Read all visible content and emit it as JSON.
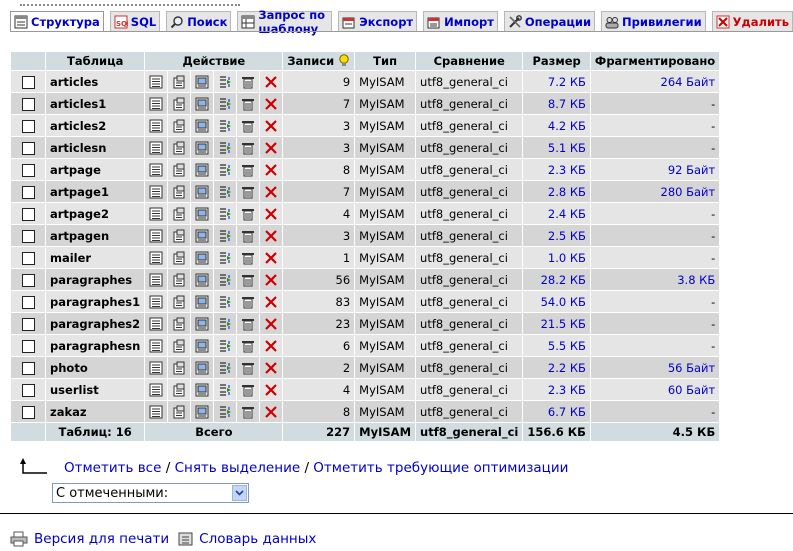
{
  "tabs": [
    {
      "label": "Структура",
      "icon": "structure-icon",
      "active": true
    },
    {
      "label": "SQL",
      "icon": "sql-icon"
    },
    {
      "label": "Поиск",
      "icon": "search-icon"
    },
    {
      "label": "Запрос по шаблону",
      "icon": "query-icon"
    },
    {
      "label": "Экспорт",
      "icon": "export-icon"
    },
    {
      "label": "Импорт",
      "icon": "import-icon"
    },
    {
      "label": "Операции",
      "icon": "operations-icon"
    },
    {
      "label": "Привилегии",
      "icon": "privileges-icon"
    },
    {
      "label": "Удалить",
      "icon": "drop-icon"
    }
  ],
  "table": {
    "headers": {
      "table": "Таблица",
      "action": "Действие",
      "records": "Записи",
      "type": "Тип",
      "collation": "Сравнение",
      "size": "Размер",
      "overhead": "Фрагментировано"
    },
    "rows": [
      {
        "name": "articles",
        "records": "9",
        "type": "MyISAM",
        "collation": "utf8_general_ci",
        "size": "7.2 КБ",
        "overhead": "264 Байт"
      },
      {
        "name": "articles1",
        "records": "7",
        "type": "MyISAM",
        "collation": "utf8_general_ci",
        "size": "8.7 КБ",
        "overhead": "-"
      },
      {
        "name": "articles2",
        "records": "3",
        "type": "MyISAM",
        "collation": "utf8_general_ci",
        "size": "4.2 КБ",
        "overhead": "-"
      },
      {
        "name": "articlesn",
        "records": "3",
        "type": "MyISAM",
        "collation": "utf8_general_ci",
        "size": "5.1 КБ",
        "overhead": "-"
      },
      {
        "name": "artpage",
        "records": "8",
        "type": "MyISAM",
        "collation": "utf8_general_ci",
        "size": "2.3 КБ",
        "overhead": "92 Байт"
      },
      {
        "name": "artpage1",
        "records": "7",
        "type": "MyISAM",
        "collation": "utf8_general_ci",
        "size": "2.8 КБ",
        "overhead": "280 Байт"
      },
      {
        "name": "artpage2",
        "records": "4",
        "type": "MyISAM",
        "collation": "utf8_general_ci",
        "size": "2.4 КБ",
        "overhead": "-"
      },
      {
        "name": "artpagen",
        "records": "3",
        "type": "MyISAM",
        "collation": "utf8_general_ci",
        "size": "2.5 КБ",
        "overhead": "-"
      },
      {
        "name": "mailer",
        "records": "1",
        "type": "MyISAM",
        "collation": "utf8_general_ci",
        "size": "1.0 КБ",
        "overhead": "-"
      },
      {
        "name": "paragraphes",
        "records": "56",
        "type": "MyISAM",
        "collation": "utf8_general_ci",
        "size": "28.2 КБ",
        "overhead": "3.8 КБ"
      },
      {
        "name": "paragraphes1",
        "records": "83",
        "type": "MyISAM",
        "collation": "utf8_general_ci",
        "size": "54.0 КБ",
        "overhead": "-"
      },
      {
        "name": "paragraphes2",
        "records": "23",
        "type": "MyISAM",
        "collation": "utf8_general_ci",
        "size": "21.5 КБ",
        "overhead": "-"
      },
      {
        "name": "paragraphesn",
        "records": "6",
        "type": "MyISAM",
        "collation": "utf8_general_ci",
        "size": "5.5 КБ",
        "overhead": "-"
      },
      {
        "name": "photo",
        "records": "2",
        "type": "MyISAM",
        "collation": "utf8_general_ci",
        "size": "2.2 КБ",
        "overhead": "56 Байт"
      },
      {
        "name": "userlist",
        "records": "4",
        "type": "MyISAM",
        "collation": "utf8_general_ci",
        "size": "2.3 КБ",
        "overhead": "60 Байт"
      },
      {
        "name": "zakaz",
        "records": "8",
        "type": "MyISAM",
        "collation": "utf8_general_ci",
        "size": "6.7 КБ",
        "overhead": "-"
      }
    ],
    "action_icons": [
      "browse-icon",
      "structure-icon",
      "search-icon",
      "insert-icon",
      "empty-icon",
      "drop-icon"
    ],
    "footer": {
      "tables": "Таблиц: 16",
      "total": "Всего",
      "records": "227",
      "type": "MyISAM",
      "collation": "utf8_general_ci",
      "size": "156.6 КБ",
      "overhead": "4.5 КБ"
    }
  },
  "selection": {
    "check_all": "Отметить все",
    "sep1": " / ",
    "uncheck_all": "Снять выделение",
    "sep2": " / ",
    "check_overhead": "Отметить требующие оптимизации"
  },
  "with_selected": {
    "value": "С отмеченными:"
  },
  "footer_links": {
    "print": "Версия для печати",
    "dictionary": "Словарь данных"
  },
  "colors": {
    "link": "#0000cc",
    "header_bg": "#d0dce0",
    "row_odd": "#e5e5e5",
    "row_even": "#d5d5d5",
    "drop": "#cc0000"
  }
}
